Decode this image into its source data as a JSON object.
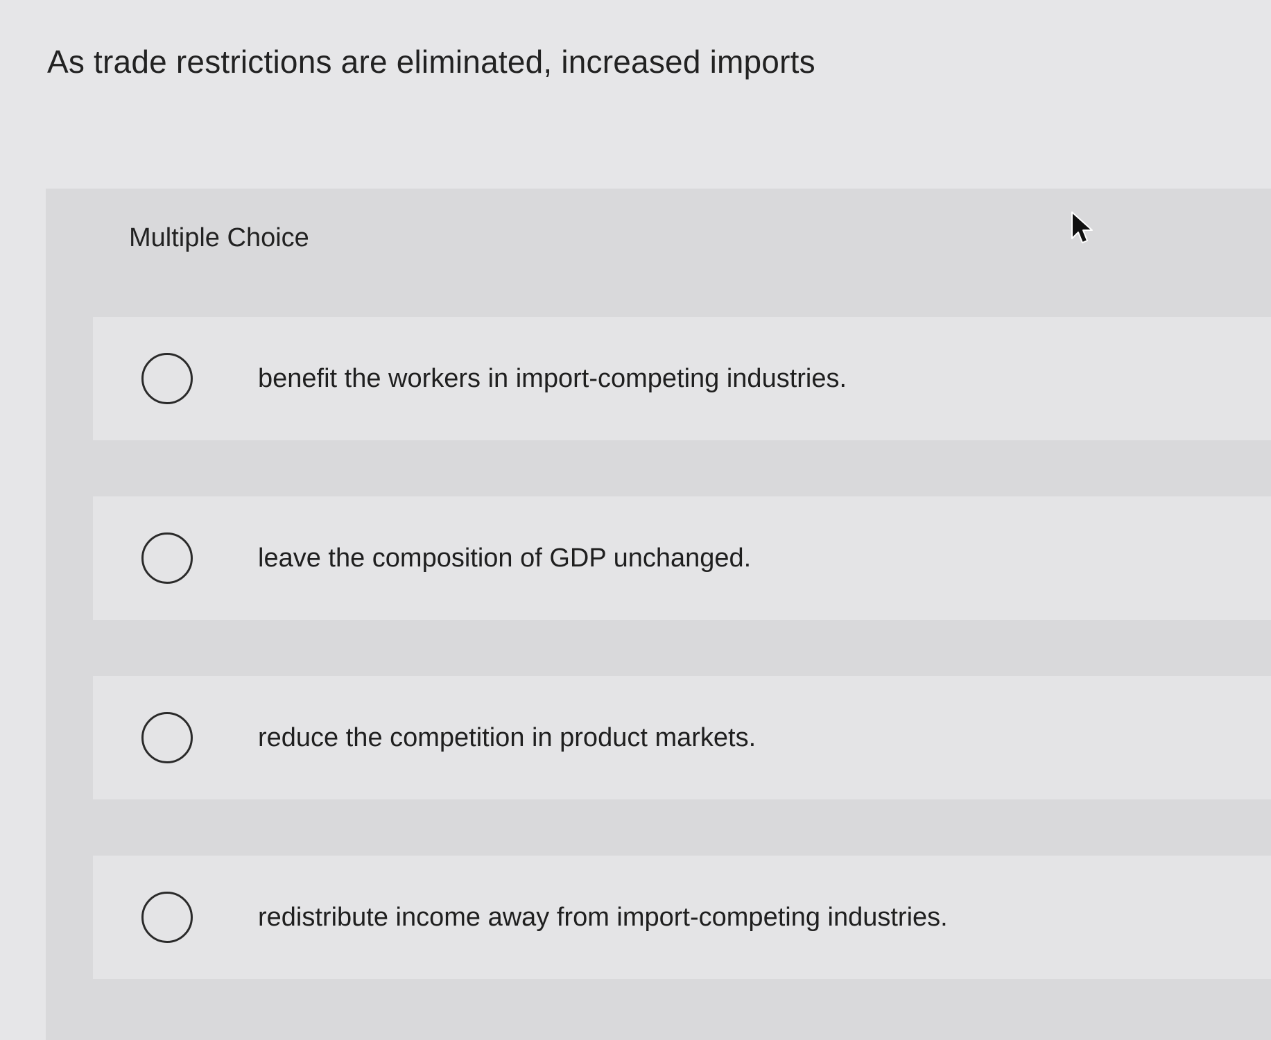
{
  "question": {
    "text": "As trade restrictions are eliminated, increased imports"
  },
  "multiple_choice": {
    "label": "Multiple Choice",
    "options": [
      {
        "label": "benefit the workers in import-competing industries.",
        "selected": false
      },
      {
        "label": "leave the composition of GDP unchanged.",
        "selected": false
      },
      {
        "label": "reduce the competition in product markets.",
        "selected": false
      },
      {
        "label": "redistribute income away from import-competing industries.",
        "selected": false
      }
    ]
  },
  "icons": {
    "radio": "radio-unselected-icon",
    "cursor": "mouse-pointer-icon"
  },
  "colors": {
    "background": "#e6e6e8",
    "panel": "#d9d9db",
    "option_row": "#e4e4e6",
    "text": "#1f1f1f"
  }
}
